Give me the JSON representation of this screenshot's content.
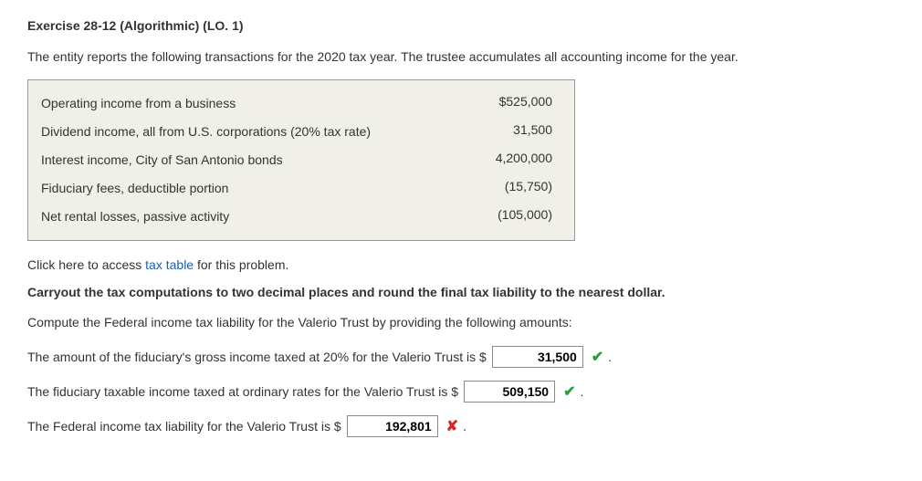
{
  "heading": "Exercise 28-12 (Algorithmic) (LO. 1)",
  "intro": "The entity reports the following transactions for the 2020 tax year. The trustee accumulates all accounting income for the year.",
  "table": {
    "rows": [
      {
        "label": "Operating income from a business",
        "value": "$525,000"
      },
      {
        "label": "Dividend income, all from U.S. corporations (20% tax rate)",
        "value": "31,500"
      },
      {
        "label": "Interest income, City of San Antonio bonds",
        "value": "4,200,000"
      },
      {
        "label": "Fiduciary fees, deductible portion",
        "value": "(15,750)"
      },
      {
        "label": "Net rental losses, passive activity",
        "value": "(105,000)"
      }
    ]
  },
  "link_line_prefix": "Click here to access ",
  "link_text": "tax table",
  "link_line_suffix": " for this problem.",
  "bold_instruction": "Carryout the tax computations to two decimal places and round the final tax liability to the nearest dollar.",
  "compute_instruction": "Compute the Federal income tax liability for the Valerio Trust by providing the following amounts:",
  "answers": [
    {
      "text": "The amount of the fiduciary's gross income taxed at 20% for the Valerio Trust is $",
      "value": "31,500",
      "status": "correct"
    },
    {
      "text": "The fiduciary taxable income taxed at ordinary rates for the Valerio Trust is $",
      "value": "509,150",
      "status": "correct"
    },
    {
      "text": "The Federal income tax liability for the Valerio Trust is $",
      "value": "192,801",
      "status": "incorrect"
    }
  ],
  "period": "."
}
